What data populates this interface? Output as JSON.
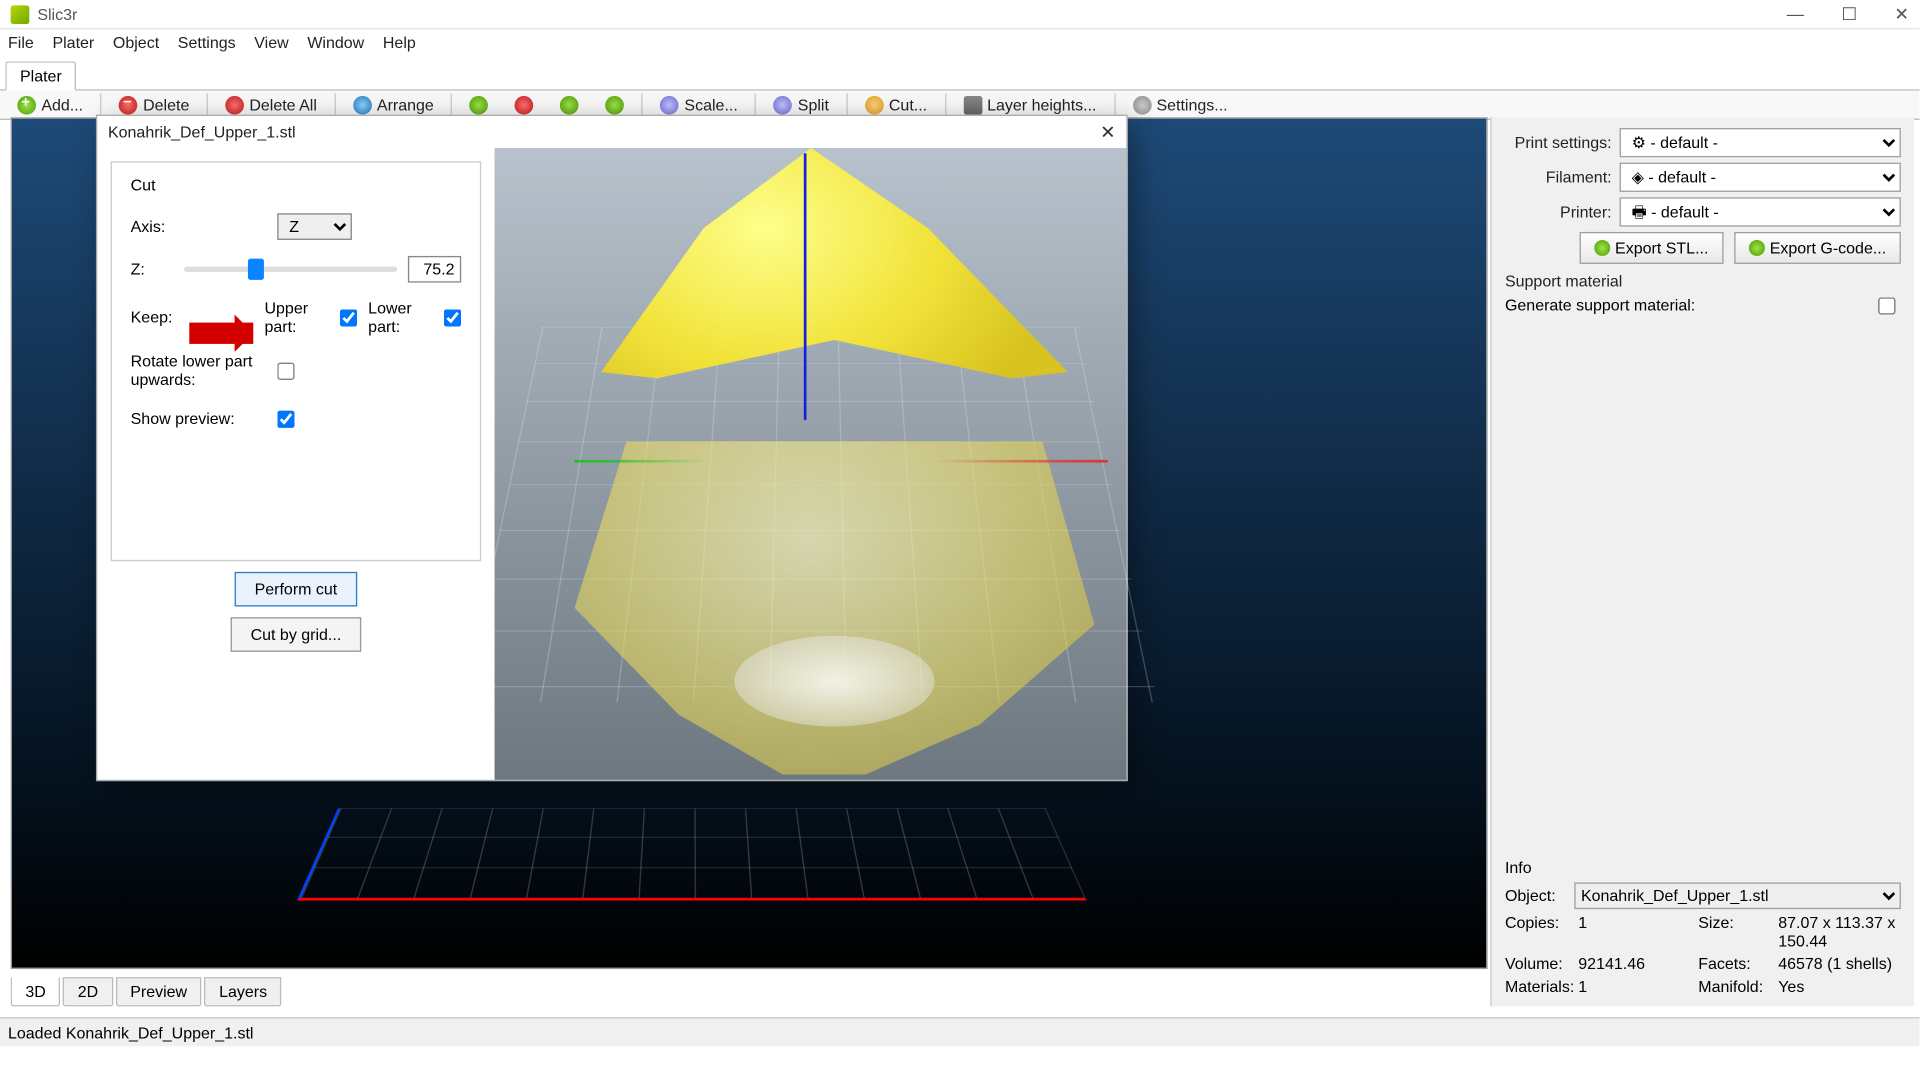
{
  "app": {
    "title": "Slic3r"
  },
  "menubar": [
    "File",
    "Plater",
    "Object",
    "Settings",
    "View",
    "Window",
    "Help"
  ],
  "main_tab": "Plater",
  "toolbar": {
    "add": "Add...",
    "delete": "Delete",
    "delete_all": "Delete All",
    "arrange": "Arrange",
    "scale": "Scale...",
    "split": "Split",
    "cut": "Cut...",
    "layer": "Layer heights...",
    "settings": "Settings..."
  },
  "view_tabs": [
    "3D",
    "2D",
    "Preview",
    "Layers"
  ],
  "right": {
    "print_label": "Print settings:",
    "filament_label": "Filament:",
    "printer_label": "Printer:",
    "default": "- default -",
    "export_stl": "Export STL...",
    "export_gcode": "Export G-code...",
    "support_head": "Support material",
    "support_label": "Generate support material:",
    "info_head": "Info",
    "object_label": "Object:",
    "object_value": "Konahrik_Def_Upper_1.stl",
    "copies_l": "Copies:",
    "copies_v": "1",
    "size_l": "Size:",
    "size_v": "87.07 x 113.37 x 150.44",
    "volume_l": "Volume:",
    "volume_v": "92141.46",
    "facets_l": "Facets:",
    "facets_v": "46578 (1 shells)",
    "materials_l": "Materials:",
    "materials_v": "1",
    "manifold_l": "Manifold:",
    "manifold_v": "Yes"
  },
  "status": "Loaded Konahrik_Def_Upper_1.stl",
  "dialog": {
    "title": "Konahrik_Def_Upper_1.stl",
    "section": "Cut",
    "axis_label": "Axis:",
    "axis_value": "Z",
    "z_label": "Z:",
    "z_value": "75.2",
    "keep_label": "Keep:",
    "upper": "Upper part:",
    "lower": "Lower part:",
    "rotate_label": "Rotate lower part upwards:",
    "preview_label": "Show preview:",
    "perform": "Perform cut",
    "grid": "Cut by grid..."
  }
}
